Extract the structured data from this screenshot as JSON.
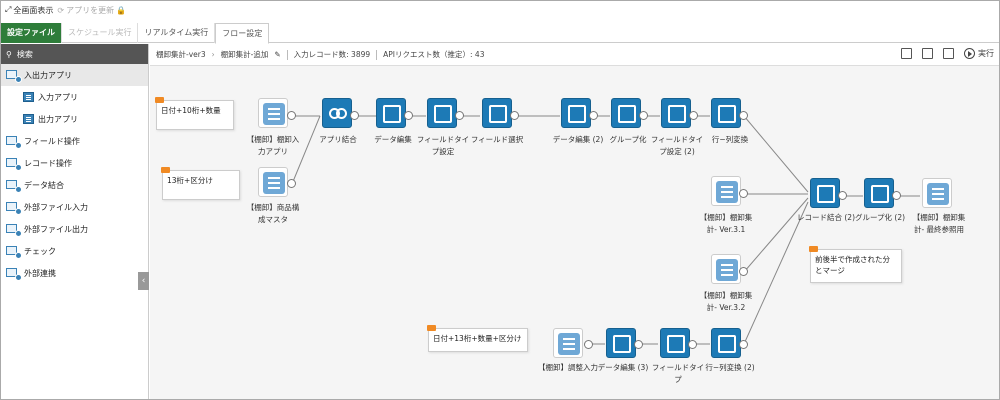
{
  "topbar": {
    "fullscreen": "全画面表示",
    "update": "アプリを更新"
  },
  "tabs": [
    {
      "label": "設定ファイル"
    },
    {
      "label": "スケジュール実行"
    },
    {
      "label": "リアルタイム実行"
    },
    {
      "label": "フロー設定"
    }
  ],
  "sidebar": {
    "search_label": "検索",
    "items": [
      {
        "label": "入出力アプリ"
      },
      {
        "label": "入力アプリ"
      },
      {
        "label": "出力アプリ"
      },
      {
        "label": "フィールド操作"
      },
      {
        "label": "レコード操作"
      },
      {
        "label": "データ結合"
      },
      {
        "label": "外部ファイル入力"
      },
      {
        "label": "外部ファイル出力"
      },
      {
        "label": "チェック"
      },
      {
        "label": "外部連携"
      }
    ]
  },
  "breadcrumb": {
    "project": "棚卸集計-ver3",
    "flow": "棚卸集計-追加",
    "records": "入力レコード数: 3899",
    "api": "APIリクエスト数（推定）: 43"
  },
  "toolbar": {
    "run": "実行"
  },
  "memos": [
    {
      "text": "日付+10桁+数量"
    },
    {
      "text": "13桁+区分け"
    },
    {
      "text": "前後半で作成された分とマージ"
    },
    {
      "text": "日付+13桁+数量+区分け"
    }
  ],
  "nodes": [
    {
      "label": "【棚卸】棚卸入力アプリ"
    },
    {
      "label": "【棚卸】商品構成マスタ"
    },
    {
      "label": "アプリ結合"
    },
    {
      "label": "データ編集"
    },
    {
      "label": "フィールドタイプ設定"
    },
    {
      "label": "フィールド選択"
    },
    {
      "label": "データ編集 (2)"
    },
    {
      "label": "グループ化"
    },
    {
      "label": "フィールドタイプ設定 (2)"
    },
    {
      "label": "行−列変換"
    },
    {
      "label": "【棚卸】棚卸集計- Ver.3.1"
    },
    {
      "label": "【棚卸】棚卸集計- Ver.3.2"
    },
    {
      "label": "レコード結合 (2)"
    },
    {
      "label": "グループ化 (2)"
    },
    {
      "label": "【棚卸】棚卸集計- 最終参照用"
    },
    {
      "label": "【棚卸】調整入力"
    },
    {
      "label": "データ編集 (3)"
    },
    {
      "label": "フィールドタイプ"
    },
    {
      "label": "行−列変換 (2)"
    }
  ]
}
